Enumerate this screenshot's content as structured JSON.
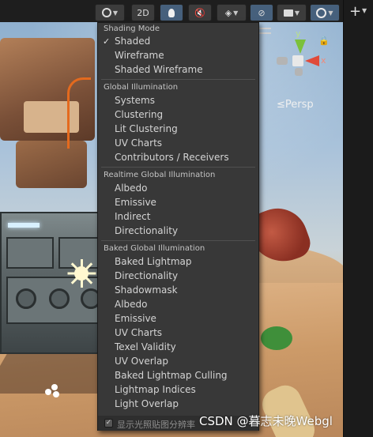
{
  "toolbar": {
    "mode_2d_label": "2D",
    "shading_icon": "sphere-shading-icon",
    "lighting_icon": "lightbulb-icon",
    "audio_icon": "audio-muted-icon",
    "effects_icon": "effects-layers-icon",
    "visibility_icon": "hidden-eye-icon",
    "camera_icon": "camera-icon",
    "gizmos_icon": "gizmos-globe-icon",
    "add_label": "+"
  },
  "scene": {
    "projection_label": "≤Persp",
    "axis_y": "y",
    "axis_x": "x"
  },
  "menu": {
    "sections": [
      {
        "header": "Shading Mode",
        "items": [
          "Shaded",
          "Wireframe",
          "Shaded Wireframe"
        ],
        "checked": "Shaded"
      },
      {
        "header": "Global Illumination",
        "items": [
          "Systems",
          "Clustering",
          "Lit Clustering",
          "UV Charts",
          "Contributors / Receivers"
        ]
      },
      {
        "header": "Realtime Global Illumination",
        "items": [
          "Albedo",
          "Emissive",
          "Indirect",
          "Directionality"
        ]
      },
      {
        "header": "Baked Global Illumination",
        "items": [
          "Baked Lightmap",
          "Directionality",
          "Shadowmask",
          "Albedo",
          "Emissive",
          "UV Charts",
          "Texel Validity",
          "UV Overlap",
          "Baked Lightmap Culling",
          "Lightmap Indices",
          "Light Overlap"
        ]
      }
    ],
    "check_mark": "✓",
    "footer_checkbox_mark": "✓",
    "footer_label": "显示光照贴图分辨率"
  },
  "watermark": "CSDN @暮志未晚Webgl",
  "colors": {
    "menu_bg": "#383838",
    "toolbar_active": "#46607c",
    "axis_y": "#7bc13a",
    "axis_x": "#e04a3a"
  }
}
